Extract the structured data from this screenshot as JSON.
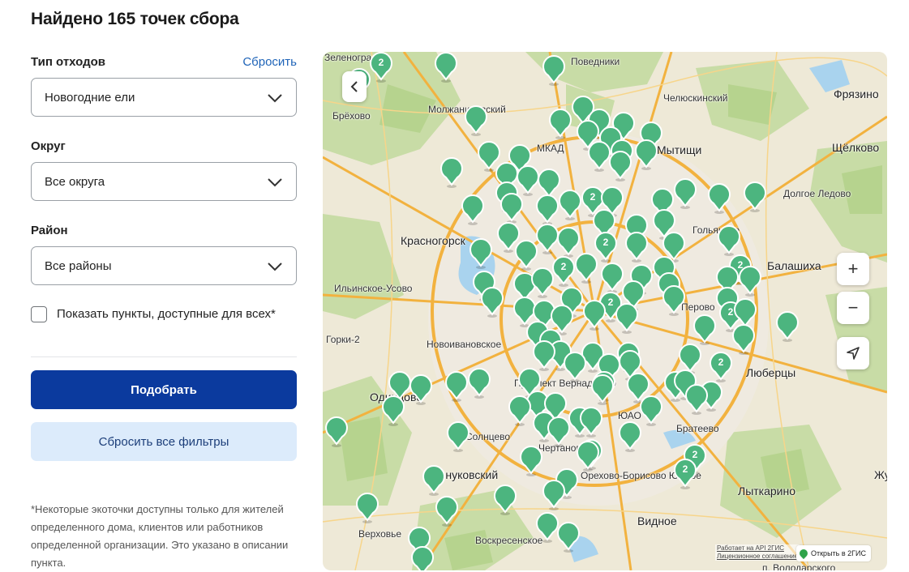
{
  "title": "Найдено 165 точек сбора",
  "filters": {
    "waste_type_label": "Тип отходов",
    "reset_label": "Сбросить",
    "waste_type_value": "Новогодние ели",
    "district_label": "Округ",
    "district_value": "Все округа",
    "area_label": "Район",
    "area_value": "Все районы",
    "show_public_label": "Показать пункты, доступные для всех*",
    "show_public_checked": false
  },
  "buttons": {
    "apply": "Подобрать",
    "reset_all": "Сбросить все фильтры"
  },
  "footnote": "*Некоторые экоточки доступны только для жителей определенного дома, клиентов или работников определенной организации. Это указано в описании пункта.",
  "map": {
    "places": [
      "Зеленоград",
      "Поведники",
      "Челюскинский",
      "Фрязино",
      "Брёхово",
      "Молжаниновский",
      "Мытищи",
      "Щёлково",
      "Долгое Ледово",
      "Красногорск",
      "Гольяново",
      "Балашиха",
      "Ильинское-Усово",
      "Горки-2",
      "Новоивановское",
      "Перово",
      "Люберцы",
      "Проспект Вернадского",
      "Одинцово",
      "Солнцево",
      "ЮАО",
      "Братеево",
      "Чертаново",
      "Орехово-Борисово Южное",
      "Внуковский",
      "Лыткарино",
      "Жуковский",
      "Видное",
      "Верховье",
      "Воскресенское",
      "п. Володарского",
      "МКАД"
    ],
    "cluster_label": "2",
    "zoom_in": "+",
    "zoom_out": "−",
    "attribution": "Работает на API 2ГИС",
    "license": "Лицензионное соглашение",
    "open_2gis": "Открыть в 2ГИС",
    "pin_color": "#4cb57f",
    "accent_color": "#0b3a9e"
  }
}
